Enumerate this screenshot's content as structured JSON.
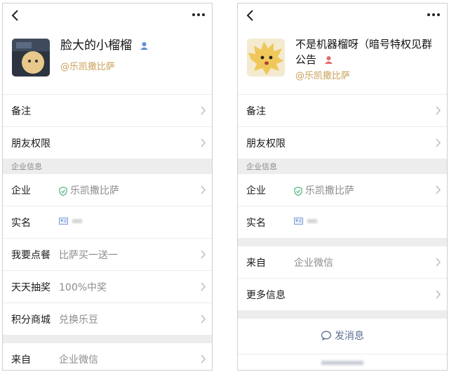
{
  "left": {
    "name": "脸大的小榴榴",
    "company": "@乐凯撒比萨",
    "rows_top": [
      {
        "label": "备注"
      },
      {
        "label": "朋友权限"
      }
    ],
    "section_title": "企业信息",
    "rows_info": [
      {
        "label": "企业",
        "value": "乐凯撒比萨"
      },
      {
        "label": "实名",
        "value": ""
      },
      {
        "label": "我要点餐",
        "value": "比萨买一送一"
      },
      {
        "label": "天天抽奖",
        "value": "100%中奖"
      },
      {
        "label": "积分商城",
        "value": "兑换乐豆"
      }
    ],
    "rows_bottom": [
      {
        "label": "来自",
        "value": "企业微信"
      }
    ]
  },
  "right": {
    "name": "不是机器榴呀（暗号特权见群公告",
    "company": "@乐凯撒比萨",
    "rows_top": [
      {
        "label": "备注"
      },
      {
        "label": "朋友权限"
      }
    ],
    "section_title": "企业信息",
    "rows_info": [
      {
        "label": "企业",
        "value": "乐凯撒比萨"
      },
      {
        "label": "实名",
        "value": ""
      }
    ],
    "rows_bottom": [
      {
        "label": "来自",
        "value": "企业微信"
      },
      {
        "label": "更多信息",
        "value": ""
      }
    ],
    "send_message": "发消息"
  },
  "colors": {
    "company_gold": "#c9a25a",
    "verified_green": "#4cb37a",
    "link_blue": "#5a6e92",
    "section_bg": "#ededed"
  },
  "icons": [
    "back-icon",
    "more-icon",
    "person-icon",
    "shield-icon",
    "id-card-icon",
    "chevron-right-icon",
    "chat-icon"
  ]
}
